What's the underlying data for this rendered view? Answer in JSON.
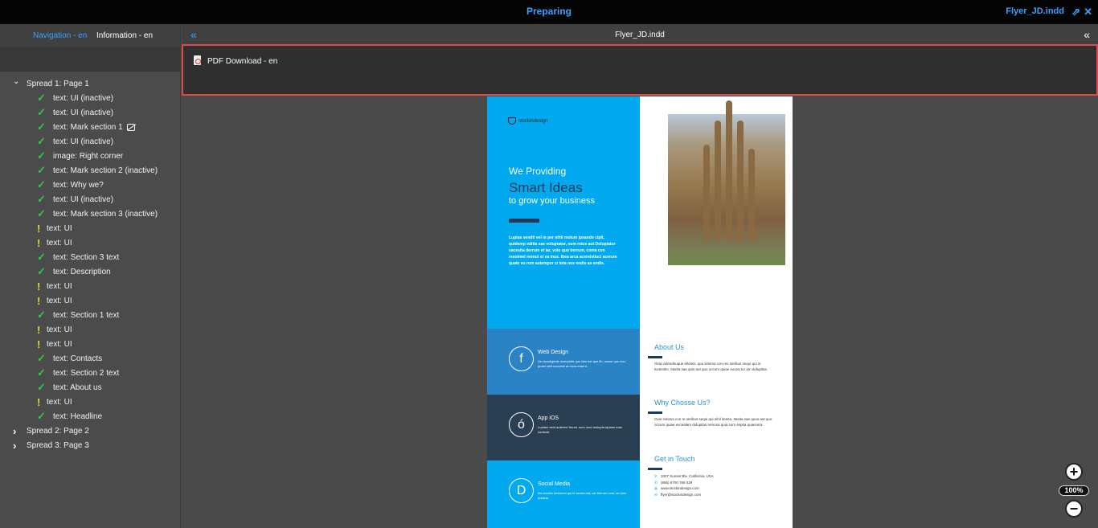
{
  "topbar": {
    "title": "Preparing",
    "file_name": "Flyer_JD.indd",
    "share_icon": "share-icon",
    "close_icon": "close-icon"
  },
  "sidebar": {
    "tabs": [
      {
        "label": "Navigation - en",
        "active": true
      },
      {
        "label": "Information - en",
        "active": false
      }
    ],
    "tree": [
      {
        "label": "Spread 1: Page 1",
        "kind": "spread",
        "expanded": true
      },
      {
        "label": "text: UI (inactive)",
        "kind": "ok"
      },
      {
        "label": "text: UI (inactive)",
        "kind": "ok"
      },
      {
        "label": "text: Mark section 1",
        "kind": "ok",
        "linked": true
      },
      {
        "label": "text: UI (inactive)",
        "kind": "ok"
      },
      {
        "label": "image: Right corner",
        "kind": "ok"
      },
      {
        "label": "text: Mark section 2 (inactive)",
        "kind": "ok"
      },
      {
        "label": "text: Why we?",
        "kind": "ok"
      },
      {
        "label": "text: UI (inactive)",
        "kind": "ok"
      },
      {
        "label": "text: Mark section 3 (inactive)",
        "kind": "ok"
      },
      {
        "label": "text: UI",
        "kind": "warn"
      },
      {
        "label": "text: UI",
        "kind": "warn"
      },
      {
        "label": "text: Section 3 text",
        "kind": "ok"
      },
      {
        "label": "text: Description",
        "kind": "ok"
      },
      {
        "label": "text: UI",
        "kind": "warn"
      },
      {
        "label": "text: UI",
        "kind": "warn"
      },
      {
        "label": "text: Section 1 text",
        "kind": "ok"
      },
      {
        "label": "text: UI",
        "kind": "warn"
      },
      {
        "label": "text: UI",
        "kind": "warn"
      },
      {
        "label": "text: Contacts",
        "kind": "ok"
      },
      {
        "label": "text: Section 2 text",
        "kind": "ok"
      },
      {
        "label": "text: About us",
        "kind": "ok"
      },
      {
        "label": "text: UI",
        "kind": "warn"
      },
      {
        "label": "text: Headline",
        "kind": "ok"
      },
      {
        "label": "Spread 2: Page 2",
        "kind": "spread",
        "expanded": false
      },
      {
        "label": "Spread 3: Page 3",
        "kind": "spread",
        "expanded": false
      }
    ]
  },
  "main": {
    "document_title": "Flyer_JD.indd",
    "pdf_download_label": "PDF Download - en"
  },
  "flyer": {
    "logo": "stockindesign",
    "headline_1": "We Providing",
    "headline_2": "Smart Ideas",
    "headline_3": "to grow your business",
    "intro": "Luptas sendit vel in per nihil molum ipsando ciplt, quidemp editia sae voluptatur, num reius aut Dolupiatur sacesita derrum et iar, volo quo berrum, conia con resolmet reenut et ea inus. Ibea arca acereistiuci acerum quate su rum autempor si tota nos endis as endis.",
    "bands": [
      {
        "icon": "f",
        "title": "Web Design",
        "text": "Us repudigenis molupiciis quo idar me que lih, conse quo con, quam velit soccesti at mora entent."
      },
      {
        "icon": "ó",
        "title": "App iOS",
        "text": "Luptam sent autenne ferum, sum mod molupta tquiam mas contenti."
      },
      {
        "icon": "D",
        "title": "Social Media",
        "text": "Ilia doloitio foremum qui le senda est, car therum nost, sa dolo duidem."
      }
    ],
    "about_title": "About Us",
    "about_text": "Osia volendeuque ellorter, qua simima con res seribus sequi qui in luctenitio. Itasita sae quis aut quo occum quiae excea tur am dolupitas.",
    "why_title": "Why Chosse Us?",
    "why_text": "Ovie simima con re seribus sequi qui nihil itenita. Itasita sae quos aut quo occum quiae excealam dolupitas remosa quia sum sepita quaecera.",
    "touch_title": "Get in Touch",
    "contacts": [
      {
        "icon": "pin-icon",
        "text": "1007 Sunset Blv. California, USA"
      },
      {
        "icon": "phone-icon",
        "text": "(856) 8700 769 029"
      },
      {
        "icon": "globe-icon",
        "text": "www.stockindesign.com"
      },
      {
        "icon": "mail-icon",
        "text": "flyer@stockindesign.com"
      }
    ]
  },
  "zoom": {
    "plus": "+",
    "minus": "−",
    "level": "100%"
  },
  "colors": {
    "accent": "#3aa0ff",
    "ok": "#2ecc40",
    "warn": "#f0d020",
    "highlight": "#e2494b",
    "flyer_blue": "#02a9ee",
    "flyer_navy": "#1f3a56",
    "flyer_mid": "#2a83c4",
    "flyer_dark": "#2b3f52"
  }
}
